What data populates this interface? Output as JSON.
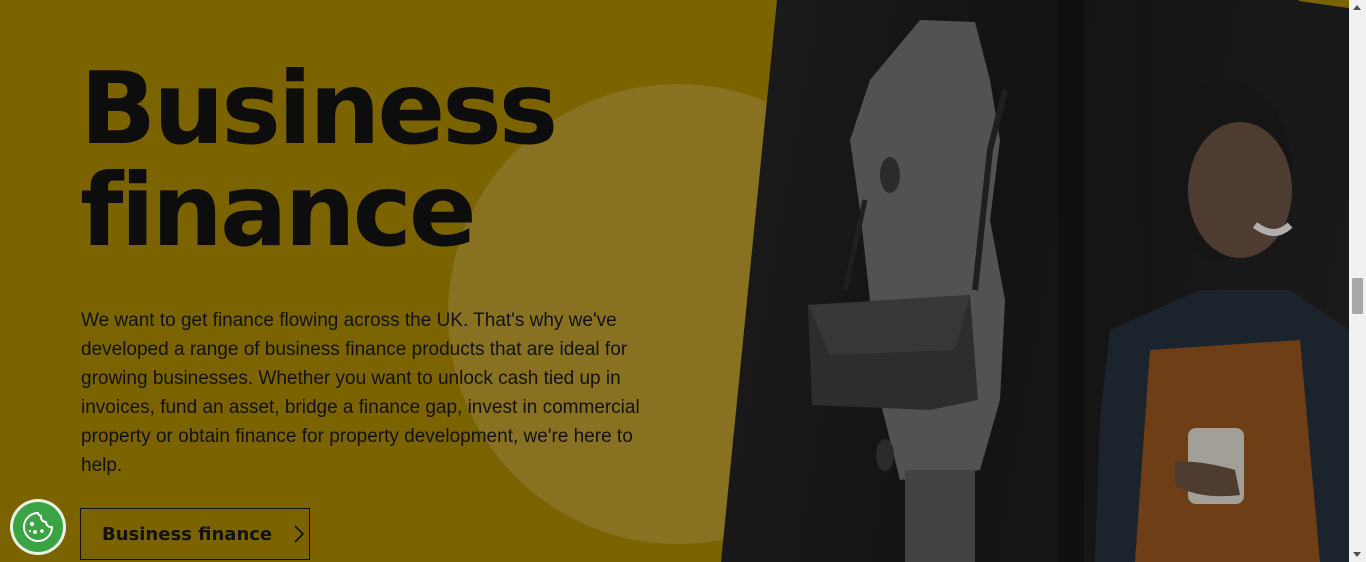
{
  "hero": {
    "heading_line1": "Business",
    "heading_line2": "finance",
    "intro": "We want to get finance flowing across the UK. That's why we've developed a range of business finance products that are ideal for growing businesses. Whether you want to unlock cash tied up in invoices, fund an asset, bridge a finance gap, invest in commercial property or obtain finance for property development, we're here to help.",
    "cta_label": "Business finance",
    "cta_icon": "chevron-right-icon"
  },
  "cookie_button": {
    "icon": "cookie-icon"
  },
  "colors": {
    "panel": "#7b6300",
    "circle": "#887121",
    "text": "#0d0d0d",
    "cookie": "#3aa344"
  }
}
